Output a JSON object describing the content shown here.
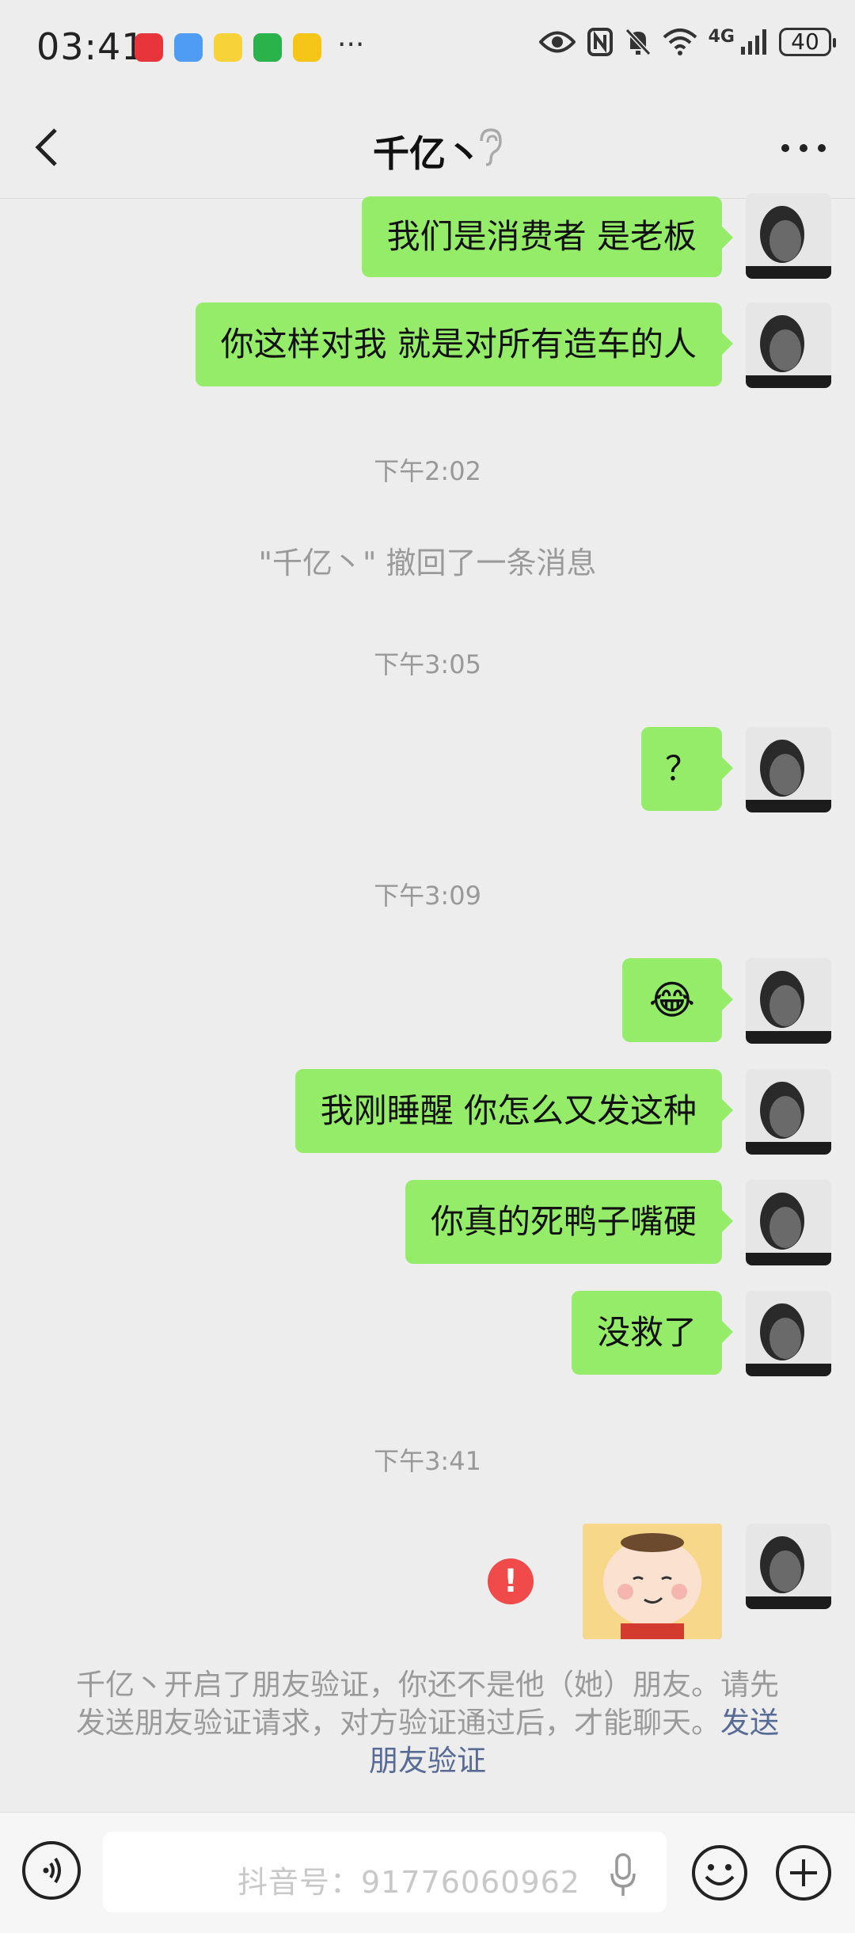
{
  "status_bar": {
    "time": "03:41",
    "app_icons": [
      "huawei-appgallery-icon",
      "file-icon",
      "video-icon",
      "wechat-icon",
      "meituan-icon"
    ],
    "more": "···",
    "network": "4G",
    "battery": "40"
  },
  "nav": {
    "title": "千亿丶"
  },
  "messages": [
    {
      "type": "text",
      "text": "我们是消费者 是老板"
    },
    {
      "type": "text",
      "text": "你这样对我 就是对所有造车的人"
    },
    {
      "type": "time",
      "text": "下午2:02"
    },
    {
      "type": "system",
      "text": "\"千亿丶\" 撤回了一条消息"
    },
    {
      "type": "time",
      "text": "下午3:05"
    },
    {
      "type": "text",
      "text": "？"
    },
    {
      "type": "time",
      "text": "下午3:09"
    },
    {
      "type": "emoji",
      "text": "😂"
    },
    {
      "type": "text",
      "text": "我刚睡醒 你怎么又发这种"
    },
    {
      "type": "text",
      "text": "你真的死鸭子嘴硬"
    },
    {
      "type": "text",
      "text": "没救了"
    },
    {
      "type": "time",
      "text": "下午3:41"
    },
    {
      "type": "sticker",
      "failed_icon": "!"
    }
  ],
  "notice": {
    "text": "千亿丶开启了朋友验证，你还不是他（她）朋友。请先发送朋友验证请求，对方验证通过后，才能聊天。",
    "link": "发送朋友验证"
  },
  "input": {
    "watermark": "抖音号：91776060962"
  },
  "colors": {
    "bubble": "#95ec69",
    "background": "#ededed",
    "link": "#576b95",
    "error": "#f04a4a"
  }
}
